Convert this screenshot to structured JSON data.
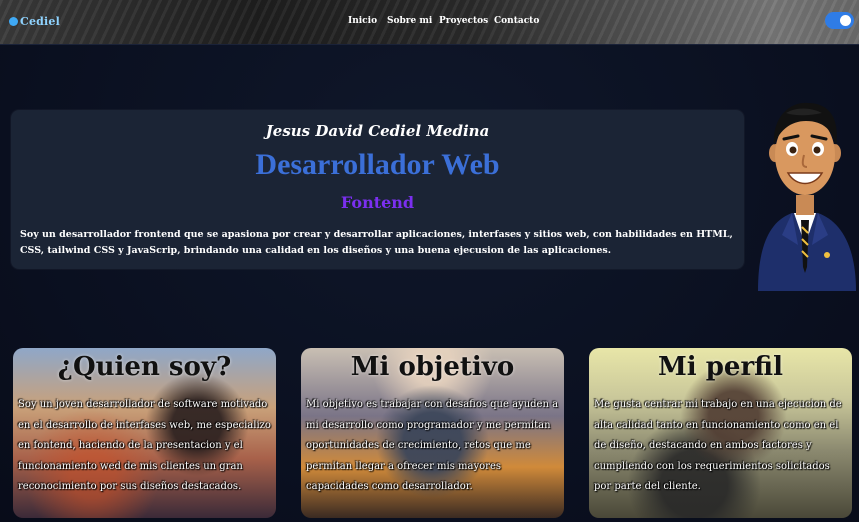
{
  "header": {
    "logo_text": "Cediel",
    "nav": [
      {
        "label": "Inicio"
      },
      {
        "label": "Sobre mi"
      },
      {
        "label": "Proyectos"
      },
      {
        "label": "Contacto"
      }
    ],
    "toggle_on": true
  },
  "hero": {
    "name": "Jesus David Cediel Medina",
    "role": "Desarrollador Web",
    "subtitle": "Fontend",
    "description": "Soy un desarrollador frontend que se apasiona por crear y desarrollar aplicaciones, interfases y sitios web, con habilidades en HTML, CSS, tailwind CSS y JavaScrip, brindando una calidad en los diseños y una buena ejecusion de las aplicaciones."
  },
  "cards": [
    {
      "title": "¿Quien soy?",
      "text": "Soy un joven desarrollador de software motivado en el desarrollo de interfases web, me especializo en fontend, haciendo de la presentacion y el funcionamiento wed de mis clientes un gran reconocimiento por sus diseños destacados."
    },
    {
      "title": "Mi objetivo",
      "text": "Mi objetivo es trabajar con desafios que ayuden a mi desarrollo como programador y me permitan oportunidades de crecimiento, retos que me permitan llegar a ofrecer mis mayores capacidades como desarrollador."
    },
    {
      "title": "Mi perfil",
      "text": "Me gusta centrar mi trabajo en una ejecucion de alta calidad tanto en funcionamiento como en el de diseño, destacando en ambos factores y cumpliendo con los requerimientos solicitados por parte del cliente."
    }
  ],
  "colors": {
    "background": "#0b1121",
    "card": "#1b2435",
    "role": "#3b6fd8",
    "subtitle": "#7b2ff0",
    "toggle": "#2f7ce6"
  }
}
